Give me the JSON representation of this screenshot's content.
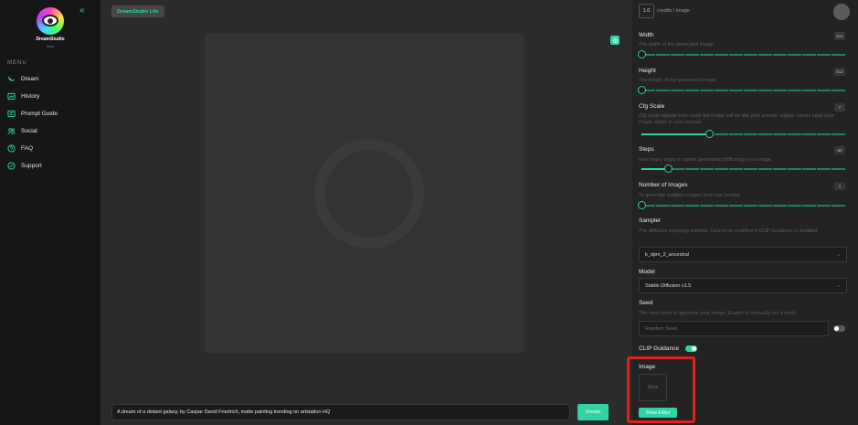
{
  "sidebar": {
    "brand": "DreamStudio",
    "brand_sub": "beta",
    "menu_label": "MENU",
    "items": [
      {
        "label": "Dream",
        "icon": "dream-icon"
      },
      {
        "label": "History",
        "icon": "history-icon"
      },
      {
        "label": "Prompt Guide",
        "icon": "prompt-guide-icon"
      },
      {
        "label": "Social",
        "icon": "social-icon"
      },
      {
        "label": "FAQ",
        "icon": "faq-icon"
      },
      {
        "label": "Support",
        "icon": "support-icon"
      }
    ]
  },
  "topbar": {
    "badge": "DreamStudio Lite",
    "credits_value": "1.0",
    "credits_label": "credits / image"
  },
  "prompt": {
    "value": "A dream of a distant galaxy, by Caspar David Friedrich, matte painting trending on artstation HQ",
    "button": "Dream"
  },
  "settings": {
    "width": {
      "label": "Width",
      "desc": "The width of the generated image.",
      "value": "512",
      "level": 0.0
    },
    "height": {
      "label": "Height",
      "desc": "The height of the generated image.",
      "value": "512",
      "level": 0.0
    },
    "cfg": {
      "label": "Cfg Scale",
      "desc": "Cfg scale adjusts how much the image will be like your prompt. Higher values keep your image closer to your prompt.",
      "value": "7",
      "level": 0.33
    },
    "steps": {
      "label": "Steps",
      "desc": "How many steps to spend generating (diffusing) your image.",
      "value": "50",
      "level": 0.13
    },
    "num_images": {
      "label": "Number of Images",
      "desc": "To generate multiple images from one prompt.",
      "value": "1",
      "level": 0.0
    },
    "sampler": {
      "label": "Sampler",
      "desc": "The diffusion sampling method. Cannot be modified if CLIP Guidance is enabled.",
      "value": "k_dpm_2_ancestral"
    },
    "model": {
      "label": "Model",
      "value": "Stable Diffusion v1.5"
    },
    "seed": {
      "label": "Seed",
      "desc": "The seed used to generate your image. Enable to manually set a seed.",
      "placeholder": "Random Seed",
      "enabled": false
    },
    "clip": {
      "label": "CLIP Guidance",
      "enabled": true
    },
    "image": {
      "label": "Image",
      "box_text": "None",
      "button": "Show Editor"
    }
  },
  "colors": {
    "accent": "#2fd3a4",
    "highlight": "#e0211d",
    "sidebar_bg": "#161616",
    "panel_bg": "#232323"
  }
}
